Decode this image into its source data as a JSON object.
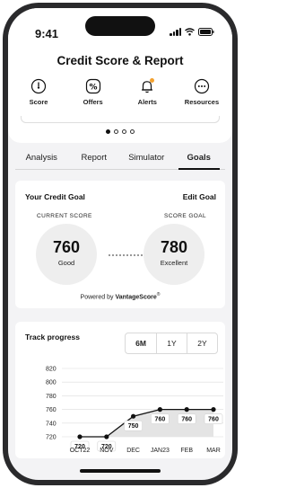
{
  "status": {
    "time": "9:41"
  },
  "header": {
    "title": "Credit Score & Report",
    "nav": [
      {
        "label": "Score",
        "icon": "gauge-icon"
      },
      {
        "label": "Offers",
        "icon": "percent-icon"
      },
      {
        "label": "Alerts",
        "icon": "bell-icon"
      },
      {
        "label": "Resources",
        "icon": "more-icon"
      }
    ]
  },
  "carousel": {
    "pages": 4,
    "active": 0
  },
  "tabs": [
    {
      "label": "Analysis",
      "active": false
    },
    {
      "label": "Report",
      "active": false
    },
    {
      "label": "Simulator",
      "active": false
    },
    {
      "label": "Goals",
      "active": true
    }
  ],
  "goal": {
    "heading": "Your Credit Goal",
    "edit_label": "Edit Goal",
    "current_label": "CURRENT SCORE",
    "goal_label": "SCORE GOAL",
    "current_score": "760",
    "current_rating": "Good",
    "goal_score": "780",
    "goal_rating": "Excellent",
    "powered_prefix": "Powered by ",
    "powered_brand": "VantageScore",
    "powered_mark": "®"
  },
  "progress": {
    "title": "Track progress",
    "periods": [
      "6M",
      "1Y",
      "2Y"
    ],
    "selected_period": "6M"
  },
  "colors": {
    "accent_alert": "#f3a12f",
    "area_fill": "#e4e4e4"
  },
  "chart_data": {
    "type": "line",
    "categories": [
      "OCT22",
      "NOV",
      "DEC",
      "JAN23",
      "FEB",
      "MAR"
    ],
    "series": [
      {
        "values": [
          720,
          720,
          750,
          760,
          760,
          760
        ]
      }
    ],
    "yticks": [
      720,
      740,
      760,
      780,
      800,
      820
    ],
    "ylim": [
      720,
      820
    ],
    "data_labels": [
      "720",
      "720",
      "750",
      "760",
      "760",
      "760"
    ],
    "grid": true,
    "area_fill": true
  }
}
